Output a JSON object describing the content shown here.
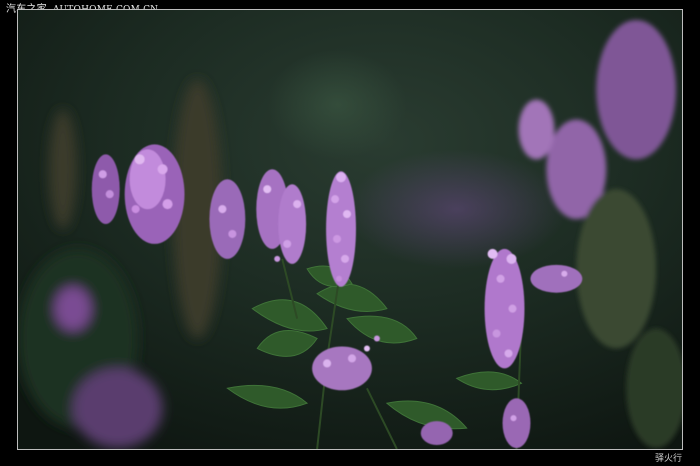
{
  "watermark": {
    "cn": "汽车之家",
    "en": "AUTOHOME.COM.CN"
  },
  "signature": "驿火行",
  "photo": {
    "subject": "purple-flower-spikes",
    "colors": {
      "background": "#1a2a1e",
      "flower": "#b77ad0",
      "leaf": "#2f5a2a"
    }
  }
}
